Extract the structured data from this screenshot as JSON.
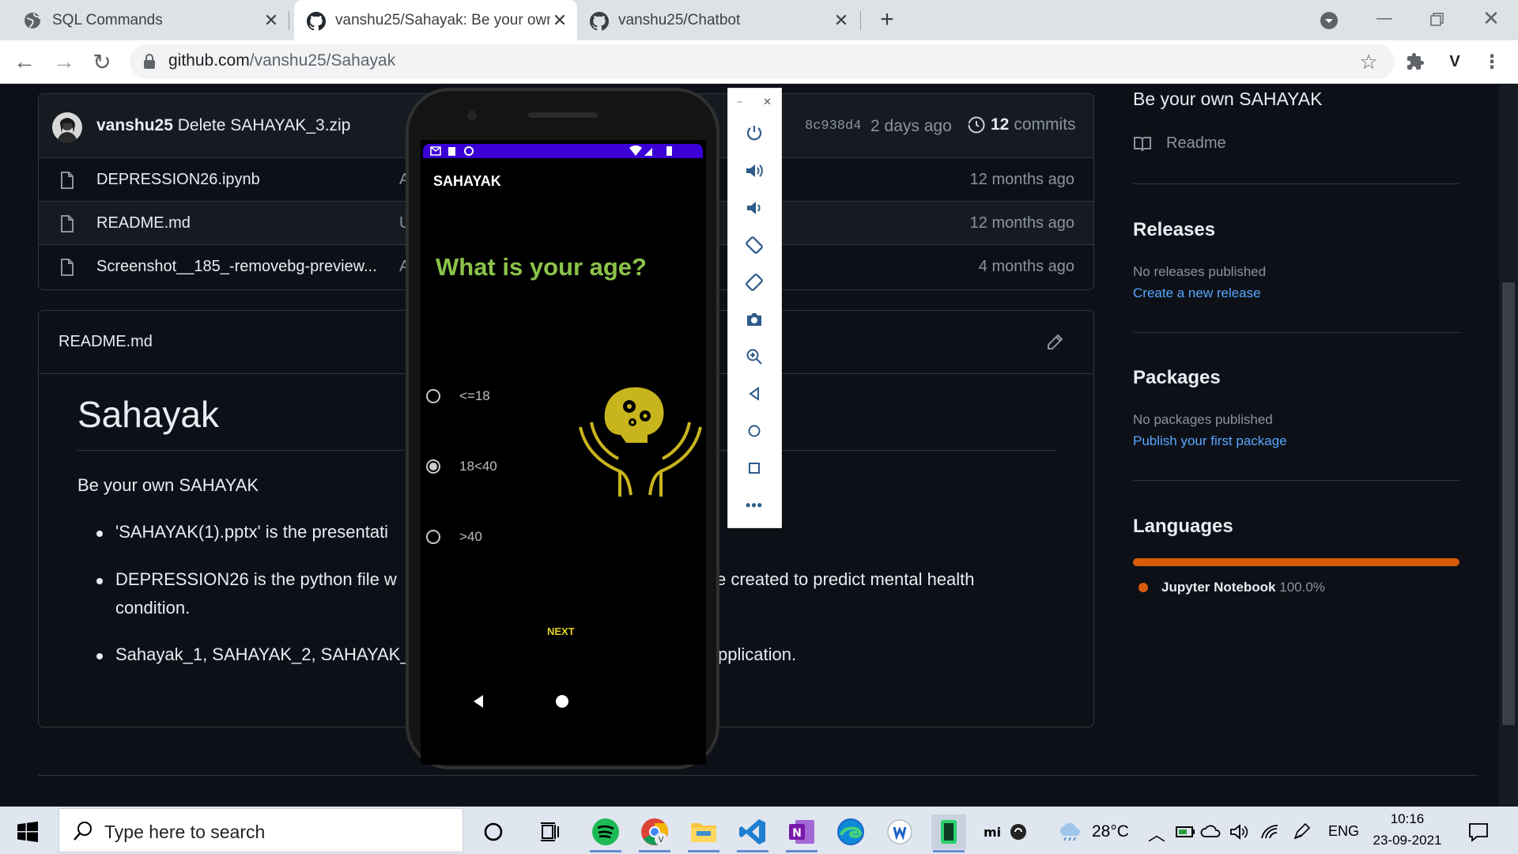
{
  "browser": {
    "tabs": [
      {
        "title": "SQL Commands",
        "active": false
      },
      {
        "title": "vanshu25/Sahayak: Be your own",
        "active": true
      },
      {
        "title": "vanshu25/Chatbot",
        "active": false
      }
    ],
    "url_host": "github.com",
    "url_path": "/vanshu25/Sahayak",
    "profile_initial": "V"
  },
  "repo": {
    "commit": {
      "author": "vanshu25",
      "message": "Delete SAHAYAK_3.zip",
      "hash": "8c938d4",
      "when": "2 days ago",
      "commits_count": "12",
      "commits_label": "commits"
    },
    "files": [
      {
        "name": "DEPRESSION26.ipynb",
        "msg": "A",
        "when": "12 months ago"
      },
      {
        "name": "README.md",
        "msg": "U",
        "when": "12 months ago"
      },
      {
        "name": "Screenshot__185_-removebg-preview...",
        "msg": "A",
        "when": "4 months ago"
      }
    ]
  },
  "readme": {
    "file_label": "README.md",
    "heading": "Sahayak",
    "tagline": "Be your own SAHAYAK",
    "bullets": [
      {
        "left": "'SAHAYAK(1).pptx' is the presentati",
        "right": ""
      },
      {
        "left": "DEPRESSION26 is the python file w",
        "right": "e created to predict mental health"
      },
      {
        "left": "Sahayak_1, SAHAYAK_2, SAHAYAK_",
        "right": "pplication."
      }
    ],
    "bullet2_line2": "condition."
  },
  "sidebar": {
    "about_text": "Be your own SAHAYAK",
    "readme_link": "Readme",
    "releases_title": "Releases",
    "releases_none": "No releases published",
    "releases_link": "Create a new release",
    "packages_title": "Packages",
    "packages_none": "No packages published",
    "packages_link": "Publish your first package",
    "languages_title": "Languages",
    "language_name": "Jupyter Notebook",
    "language_pct": "100.0%",
    "language_color": "#da5b0b"
  },
  "emulator": {
    "app_title": "SAHAYAK",
    "question": "What is your age?",
    "options": [
      {
        "label": "<=18",
        "selected": false
      },
      {
        "label": "18<40",
        "selected": true
      },
      {
        "label": ">40",
        "selected": false
      }
    ],
    "next_label": "NEXT",
    "question_color": "#8bc34a",
    "logo_color": "#c8b51d",
    "statusbar_color": "#3a00d6",
    "panel_icons": [
      "power-icon",
      "volume-up-icon",
      "volume-down-icon",
      "rotate-left-icon",
      "rotate-right-icon",
      "camera-icon",
      "zoom-icon",
      "back-icon",
      "home-icon",
      "overview-icon",
      "more-icon"
    ]
  },
  "taskbar": {
    "search_placeholder": "Type here to search",
    "weather": "28°C",
    "language": "ENG",
    "time": "10:16",
    "date": "23-09-2021"
  }
}
